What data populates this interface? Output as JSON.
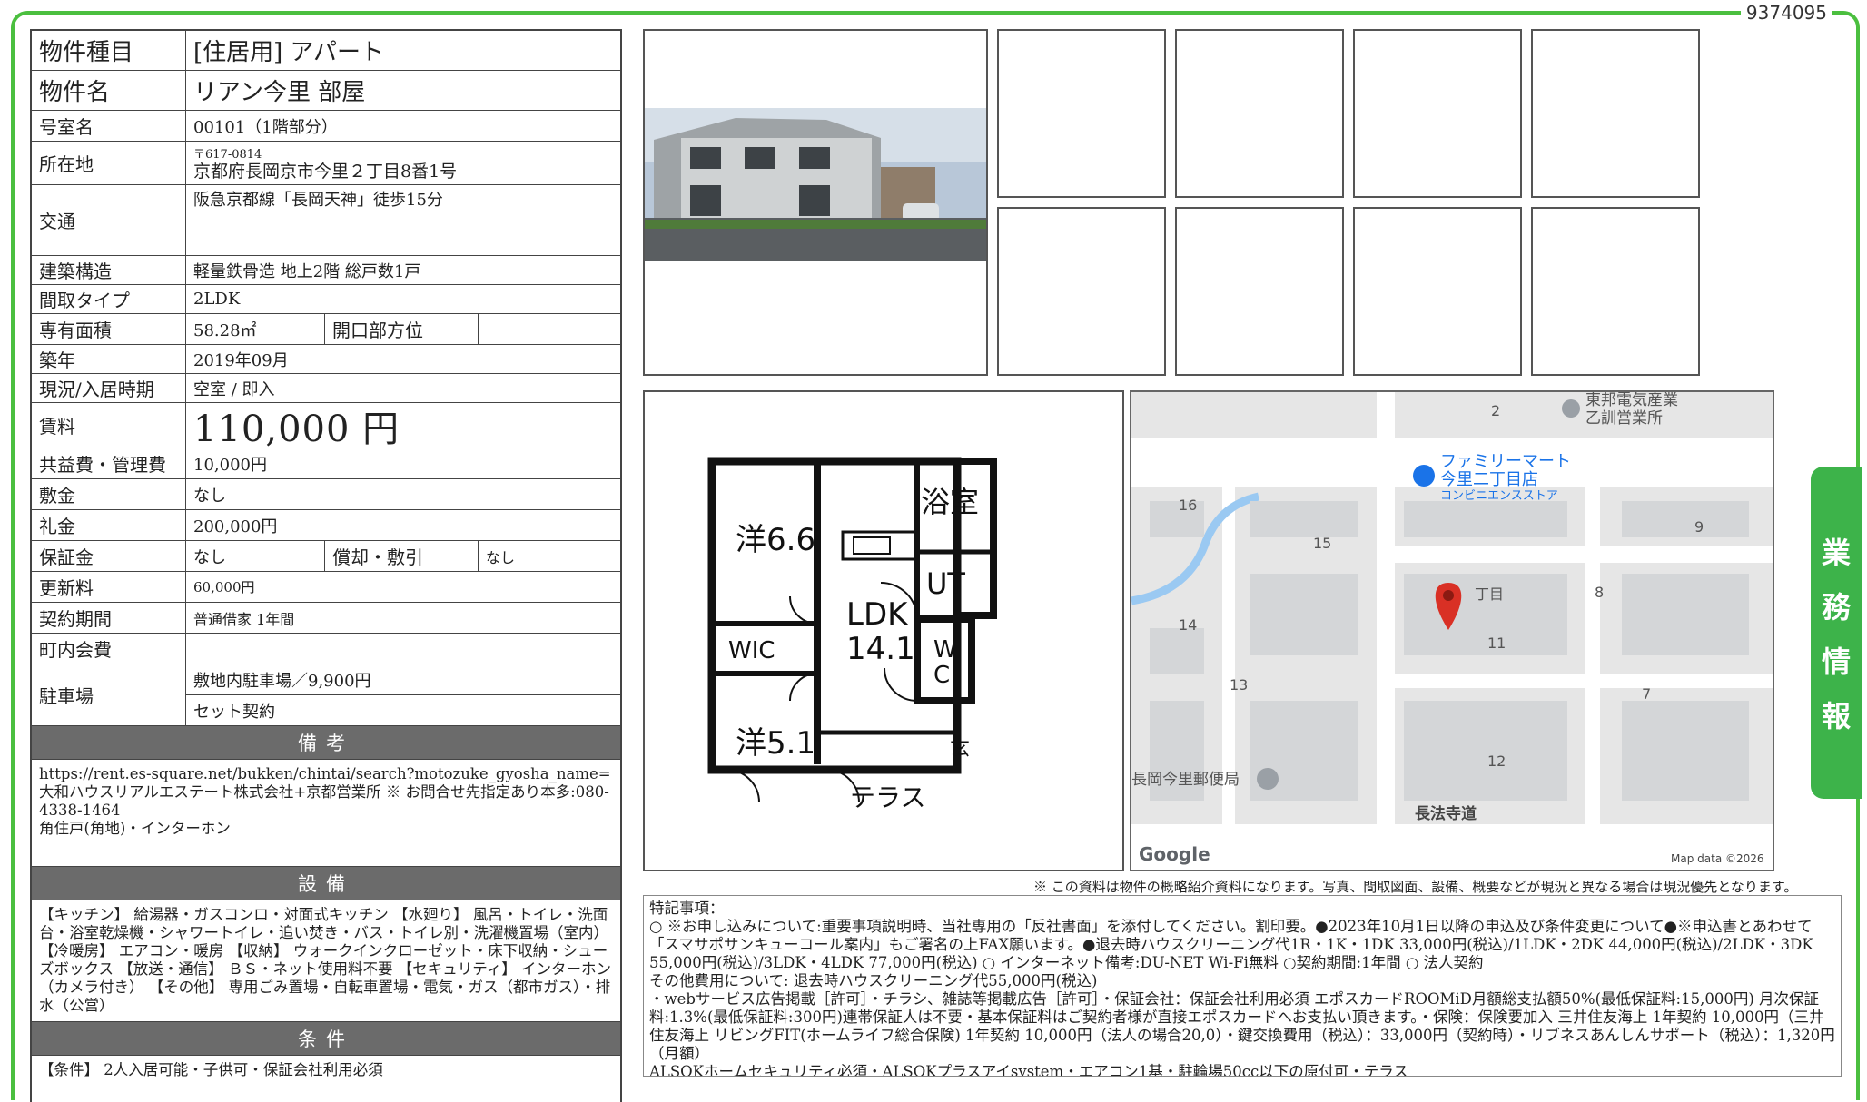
{
  "doc_id": "9374095",
  "side_tab": [
    "業",
    "務",
    "情",
    "報"
  ],
  "info": {
    "type_label": "物件種目",
    "type_value": "[住居用] アパート",
    "name_label": "物件名",
    "name_value": "リアン今里 部屋",
    "room_label": "号室名",
    "room_value": "00101（1階部分）",
    "address_label": "所在地",
    "postal": "〒617-0814",
    "address_value": "京都府長岡京市今里２丁目8番1号",
    "access_label": "交通",
    "access_value": "阪急京都線「長岡天神」徒歩15分",
    "structure_label": "建築構造",
    "structure_value": "軽量鉄骨造 地上2階 総戸数1戸",
    "layout_label": "間取タイプ",
    "layout_value": "2LDK",
    "area_label": "専有面積",
    "area_value": "58.28㎡",
    "opening_label": "開口部方位",
    "opening_value": "",
    "built_label": "築年",
    "built_value": "2019年09月",
    "status_label": "現況/入居時期",
    "status_value": "空室 / 即入",
    "rent_label": "賃料",
    "rent_value": "110,000 円",
    "fee_label": "共益費・管理費",
    "fee_value": "10,000円",
    "deposit_label": "敷金",
    "deposit_value": "なし",
    "key_label": "礼金",
    "key_value": "200,000円",
    "guarantee_label": "保証金",
    "guarantee_value": "なし",
    "amort_label": "償却・敷引",
    "amort_value": "なし",
    "renew_label": "更新料",
    "renew_value": "60,000円",
    "contract_label": "契約期間",
    "contract_value": "普通借家 1年間",
    "town_label": "町内会費",
    "town_value": "",
    "parking_label": "駐車場",
    "parking_value1": "敷地内駐車場／9,900円",
    "parking_value2": "セット契約"
  },
  "remarks": {
    "head": "備考",
    "text": "https://rent.es-square.net/bukken/chintai/search?motozuke_gyosha_name=大和ハウスリアルエステート株式会社+京都営業所 ※ お問合せ先指定あり本多:080-4338-1464\n角住戸(角地)・インターホン"
  },
  "equipment": {
    "head": "設備",
    "text": "【キッチン】 給湯器・ガスコンロ・対面式キッチン 【水廻り】 風呂・トイレ・洗面台・浴室乾燥機・シャワートイレ・追い焚き・バス・トイレ別・洗濯機置場（室内） 【冷暖房】 エアコン・暖房 【収納】 ウォークインクローゼット・床下収納・シューズボックス 【放送・通信】 ＢＳ・ネット使用料不要 【セキュリティ】 インターホン（カメラ付き） 【その他】 専用ごみ置場・自転車置場・電気・ガス（都市ガス）・排水（公営）"
  },
  "conditions": {
    "head": "条件",
    "text": "【条件】 2人入居可能・子供可・保証会社利用必須"
  },
  "floorplan": {
    "rooms": [
      "洋6.6",
      "LDK",
      "14.1",
      "浴室",
      "UT",
      "WIC",
      "W",
      "C",
      "洋5.1",
      "玄",
      "テラス"
    ]
  },
  "map": {
    "labels": [
      "東邦電気産業",
      "乙訓営業所",
      "ファミリーマート",
      "今里二丁目店",
      "コンビニエンスストア",
      "2",
      "16",
      "15",
      "9",
      "8",
      "14",
      "11",
      "13",
      "7",
      "12",
      "丁目",
      "長岡今里郵便局",
      "長法寺道",
      "Google",
      "Map data ©2026"
    ]
  },
  "disclaimer": "※ この資料は物件の概略紹介資料になります。写真、間取図面、設備、概要などが現況と異なる場合は現況優先となります。",
  "special": {
    "head": "特記事項：",
    "lines": [
      "○ ※お申し込みについて:重要事項説明時、当社専用の「反社書面」を添付してください。割印要。●2023年10月1日以降の申込及び条件変更について●※申込書とあわせて「スマサポサンキューコール案内」もご署名の上FAX願います。●退去時ハウスクリーニング代1R・1K・1DK 33,000円(税込)/1LDK・2DK 44,000円(税込)/2LDK・3DK 55,000円(税込)/3LDK・4LDK 77,000円(税込) ○ インターネット備考:DU-NET Wi-Fi無料 ○契約期間:1年間 ○ 法人契約",
      "その他費用について: 退去時ハウスクリーニング代55,000円(税込)",
      "・webサービス広告掲載［許可］・チラシ、雑誌等掲載広告［許可］・保証会社：保証会社利用必須 エポスカードROOMiD月額総支払額50%(最低保証料:15,000円) 月次保証料:1.3%(最低保証料:300円)連帯保証人は不要・基本保証料はご契約者様が直接エポスカードへお支払い頂きます。・保険：保険要加入 三井住友海上 1年契約 10,000円（三井住友海上 リビングFIT(ホームライフ総合保険) 1年契約 10,000円（法人の場合20,0）・鍵交換費用（税込）：33,000円（契約時）・リブネスあんしんサポート（税込）：1,320円（月額）",
      "ALSOKホームセキュリティ必須・ALSOKプラスアイsystem・エアコン1基・駐輪場50cc以下の原付可・テラス"
    ]
  }
}
